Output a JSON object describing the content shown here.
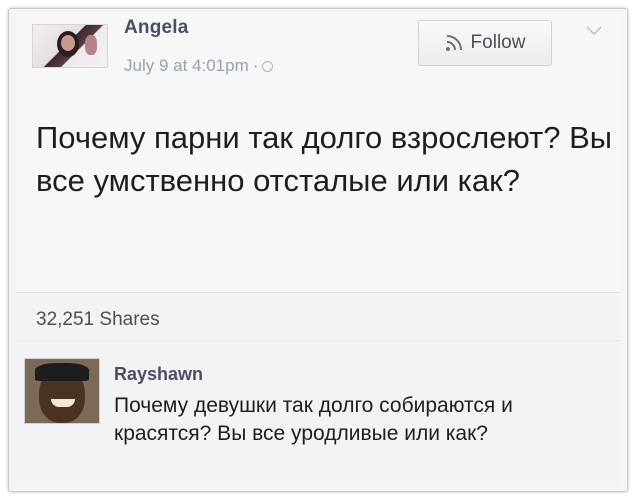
{
  "post": {
    "author": "Angela",
    "date": "July 9 at 4:01pm",
    "meta_separator": "·",
    "follow_label": "Follow",
    "text": "Почему парни так долго взрослеют? Вы все умственно отсталые или как?",
    "shares": "32,251 Shares"
  },
  "comment": {
    "author": "Rayshawn",
    "text": "Почему девушки так долго собираются и красятся? Вы все уродливые или как?"
  },
  "icons": {
    "follow": "rss-icon",
    "menu": "chevron-down-icon",
    "privacy": "globe-icon"
  }
}
